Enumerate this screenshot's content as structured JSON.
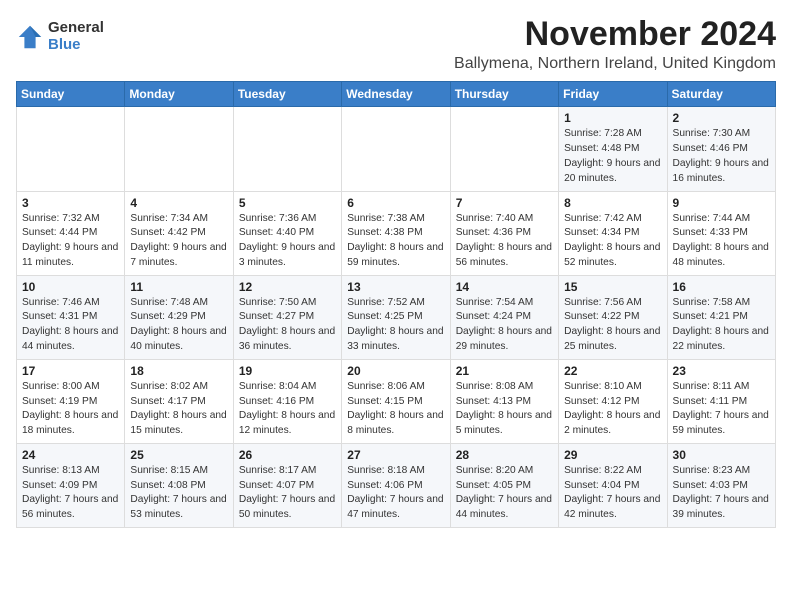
{
  "logo": {
    "general": "General",
    "blue": "Blue"
  },
  "title": "November 2024",
  "location": "Ballymena, Northern Ireland, United Kingdom",
  "days_of_week": [
    "Sunday",
    "Monday",
    "Tuesday",
    "Wednesday",
    "Thursday",
    "Friday",
    "Saturday"
  ],
  "weeks": [
    [
      {
        "day": "",
        "info": ""
      },
      {
        "day": "",
        "info": ""
      },
      {
        "day": "",
        "info": ""
      },
      {
        "day": "",
        "info": ""
      },
      {
        "day": "",
        "info": ""
      },
      {
        "day": "1",
        "info": "Sunrise: 7:28 AM\nSunset: 4:48 PM\nDaylight: 9 hours and 20 minutes."
      },
      {
        "day": "2",
        "info": "Sunrise: 7:30 AM\nSunset: 4:46 PM\nDaylight: 9 hours and 16 minutes."
      }
    ],
    [
      {
        "day": "3",
        "info": "Sunrise: 7:32 AM\nSunset: 4:44 PM\nDaylight: 9 hours and 11 minutes."
      },
      {
        "day": "4",
        "info": "Sunrise: 7:34 AM\nSunset: 4:42 PM\nDaylight: 9 hours and 7 minutes."
      },
      {
        "day": "5",
        "info": "Sunrise: 7:36 AM\nSunset: 4:40 PM\nDaylight: 9 hours and 3 minutes."
      },
      {
        "day": "6",
        "info": "Sunrise: 7:38 AM\nSunset: 4:38 PM\nDaylight: 8 hours and 59 minutes."
      },
      {
        "day": "7",
        "info": "Sunrise: 7:40 AM\nSunset: 4:36 PM\nDaylight: 8 hours and 56 minutes."
      },
      {
        "day": "8",
        "info": "Sunrise: 7:42 AM\nSunset: 4:34 PM\nDaylight: 8 hours and 52 minutes."
      },
      {
        "day": "9",
        "info": "Sunrise: 7:44 AM\nSunset: 4:33 PM\nDaylight: 8 hours and 48 minutes."
      }
    ],
    [
      {
        "day": "10",
        "info": "Sunrise: 7:46 AM\nSunset: 4:31 PM\nDaylight: 8 hours and 44 minutes."
      },
      {
        "day": "11",
        "info": "Sunrise: 7:48 AM\nSunset: 4:29 PM\nDaylight: 8 hours and 40 minutes."
      },
      {
        "day": "12",
        "info": "Sunrise: 7:50 AM\nSunset: 4:27 PM\nDaylight: 8 hours and 36 minutes."
      },
      {
        "day": "13",
        "info": "Sunrise: 7:52 AM\nSunset: 4:25 PM\nDaylight: 8 hours and 33 minutes."
      },
      {
        "day": "14",
        "info": "Sunrise: 7:54 AM\nSunset: 4:24 PM\nDaylight: 8 hours and 29 minutes."
      },
      {
        "day": "15",
        "info": "Sunrise: 7:56 AM\nSunset: 4:22 PM\nDaylight: 8 hours and 25 minutes."
      },
      {
        "day": "16",
        "info": "Sunrise: 7:58 AM\nSunset: 4:21 PM\nDaylight: 8 hours and 22 minutes."
      }
    ],
    [
      {
        "day": "17",
        "info": "Sunrise: 8:00 AM\nSunset: 4:19 PM\nDaylight: 8 hours and 18 minutes."
      },
      {
        "day": "18",
        "info": "Sunrise: 8:02 AM\nSunset: 4:17 PM\nDaylight: 8 hours and 15 minutes."
      },
      {
        "day": "19",
        "info": "Sunrise: 8:04 AM\nSunset: 4:16 PM\nDaylight: 8 hours and 12 minutes."
      },
      {
        "day": "20",
        "info": "Sunrise: 8:06 AM\nSunset: 4:15 PM\nDaylight: 8 hours and 8 minutes."
      },
      {
        "day": "21",
        "info": "Sunrise: 8:08 AM\nSunset: 4:13 PM\nDaylight: 8 hours and 5 minutes."
      },
      {
        "day": "22",
        "info": "Sunrise: 8:10 AM\nSunset: 4:12 PM\nDaylight: 8 hours and 2 minutes."
      },
      {
        "day": "23",
        "info": "Sunrise: 8:11 AM\nSunset: 4:11 PM\nDaylight: 7 hours and 59 minutes."
      }
    ],
    [
      {
        "day": "24",
        "info": "Sunrise: 8:13 AM\nSunset: 4:09 PM\nDaylight: 7 hours and 56 minutes."
      },
      {
        "day": "25",
        "info": "Sunrise: 8:15 AM\nSunset: 4:08 PM\nDaylight: 7 hours and 53 minutes."
      },
      {
        "day": "26",
        "info": "Sunrise: 8:17 AM\nSunset: 4:07 PM\nDaylight: 7 hours and 50 minutes."
      },
      {
        "day": "27",
        "info": "Sunrise: 8:18 AM\nSunset: 4:06 PM\nDaylight: 7 hours and 47 minutes."
      },
      {
        "day": "28",
        "info": "Sunrise: 8:20 AM\nSunset: 4:05 PM\nDaylight: 7 hours and 44 minutes."
      },
      {
        "day": "29",
        "info": "Sunrise: 8:22 AM\nSunset: 4:04 PM\nDaylight: 7 hours and 42 minutes."
      },
      {
        "day": "30",
        "info": "Sunrise: 8:23 AM\nSunset: 4:03 PM\nDaylight: 7 hours and 39 minutes."
      }
    ]
  ]
}
